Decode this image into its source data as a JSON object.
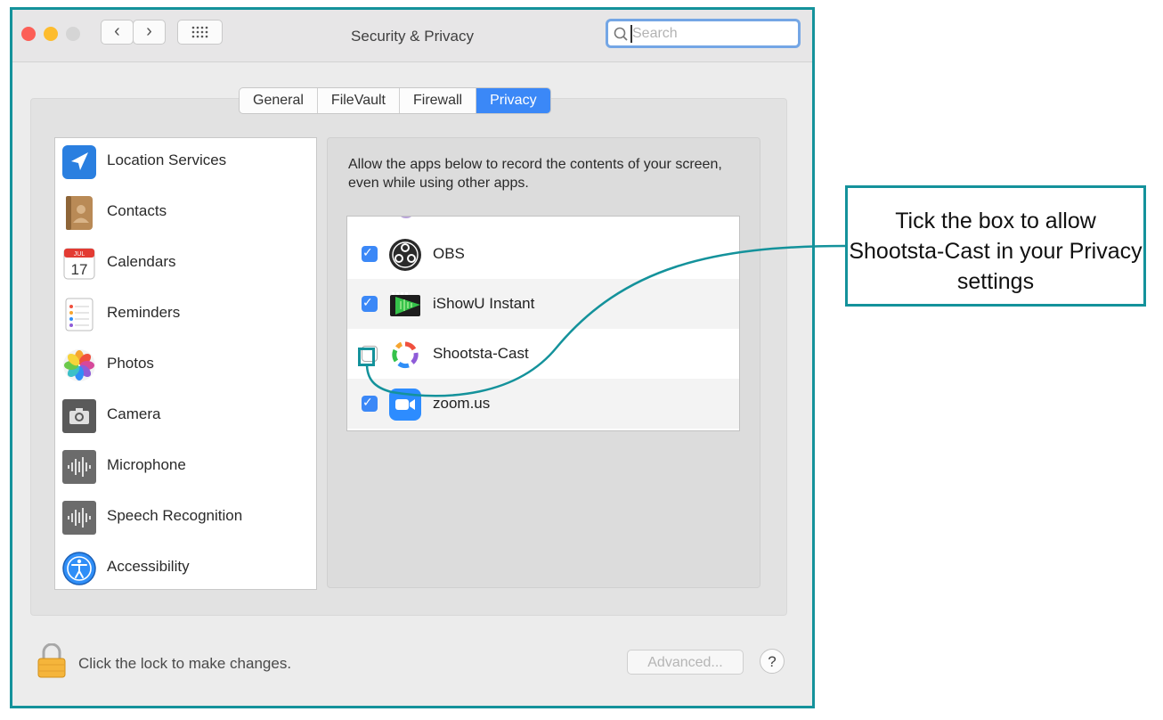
{
  "window": {
    "title": "Security & Privacy",
    "search_placeholder": "Search"
  },
  "tabs": [
    {
      "label": "General",
      "active": false
    },
    {
      "label": "FileVault",
      "active": false
    },
    {
      "label": "Firewall",
      "active": false
    },
    {
      "label": "Privacy",
      "active": true
    }
  ],
  "sidebar": {
    "items": [
      {
        "label": "Location Services",
        "icon": "location-arrow-icon"
      },
      {
        "label": "Contacts",
        "icon": "contacts-book-icon"
      },
      {
        "label": "Calendars",
        "icon": "calendar-icon"
      },
      {
        "label": "Reminders",
        "icon": "reminders-list-icon"
      },
      {
        "label": "Photos",
        "icon": "photos-flower-icon"
      },
      {
        "label": "Camera",
        "icon": "camera-icon"
      },
      {
        "label": "Microphone",
        "icon": "microphone-waveform-icon"
      },
      {
        "label": "Speech Recognition",
        "icon": "speech-waveform-icon"
      },
      {
        "label": "Accessibility",
        "icon": "accessibility-icon"
      }
    ]
  },
  "calendar_icon": {
    "month": "JUL",
    "day": "17"
  },
  "main": {
    "description": "Allow the apps below to record the contents of your screen, even while using other apps.",
    "apps": [
      {
        "label": "OBS",
        "checked": true,
        "icon": "obs-icon"
      },
      {
        "label": "iShowU Instant",
        "checked": true,
        "icon": "ishowu-icon"
      },
      {
        "label": "Shootsta-Cast",
        "checked": false,
        "icon": "shootsta-cast-icon"
      },
      {
        "label": "zoom.us",
        "checked": true,
        "icon": "zoom-camera-icon"
      }
    ]
  },
  "footer": {
    "lock_text": "Click the lock to make changes.",
    "advanced_label": "Advanced...",
    "help_label": "?"
  },
  "callout": {
    "text": "Tick the box to allow Shootsta-Cast in your Privacy settings"
  },
  "colors": {
    "accent": "#3b88f7",
    "annotation": "#14929b"
  }
}
